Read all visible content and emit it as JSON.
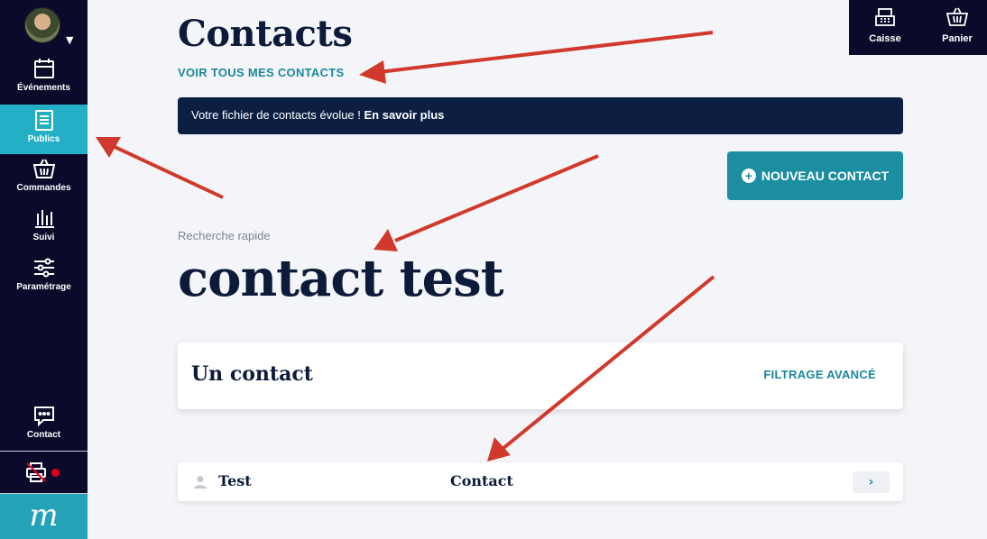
{
  "sidebar": {
    "items": [
      {
        "label": "Événements",
        "icon": "calendar-icon"
      },
      {
        "label": "Publics",
        "icon": "document-icon",
        "active": true
      },
      {
        "label": "Commandes",
        "icon": "basket-icon"
      },
      {
        "label": "Suivi",
        "icon": "bar-chart-icon"
      },
      {
        "label": "Paramétrage",
        "icon": "sliders-icon"
      }
    ],
    "contact_label": "Contact",
    "logo_text": "m"
  },
  "topbar": {
    "caisse_label": "Caisse",
    "panier_label": "Panier"
  },
  "main": {
    "title": "Contacts",
    "all_contacts_link": "VOIR TOUS MES CONTACTS",
    "banner_text": "Votre fichier de contacts évolue ! ",
    "banner_link": "En savoir plus",
    "new_contact_button": "NOUVEAU CONTACT",
    "search_label": "Recherche rapide",
    "search_term": "contact test",
    "result_count": "Un contact",
    "filter_link": "FILTRAGE AVANCÉ",
    "contacts": [
      {
        "first_name": "Test",
        "last_name": "Contact"
      }
    ]
  },
  "colors": {
    "sidebar_bg": "#0b0a2b",
    "accent": "#23b0c7",
    "link": "#1b879c",
    "banner_bg": "#0c1f43",
    "annotation_arrow": "#d0392b"
  }
}
